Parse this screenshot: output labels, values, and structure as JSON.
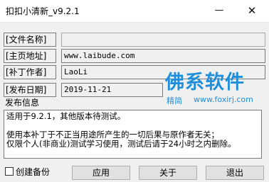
{
  "window": {
    "title": "扣扣小清新_v9.2.1",
    "minimize": "—",
    "close": "✕"
  },
  "fields": [
    {
      "label": "[文件名称]",
      "value": ""
    },
    {
      "label": "[主页地址]",
      "value": "www.laibude.com"
    },
    {
      "label": "[补丁作者]",
      "value": "LaoLi"
    },
    {
      "label": "[发布日期]",
      "value": "2019-11-21"
    }
  ],
  "watermark": {
    "brand": "佛系软件",
    "tag": "精简",
    "url": "www.foxirj.com"
  },
  "info": {
    "label": "发布信息",
    "lines": [
      "适用于9.2.1，其他版本待测试。",
      "",
      "使用本补丁于不正当用途所产生的一切后果与原作者无关；",
      "仅限个人(非商业)测试学习使用，测试后请于24小时之内删除。"
    ]
  },
  "footer": {
    "backup_label": "创建备份",
    "backup_checked": false,
    "apply": "应用",
    "about": "关于",
    "exit": "退出"
  }
}
